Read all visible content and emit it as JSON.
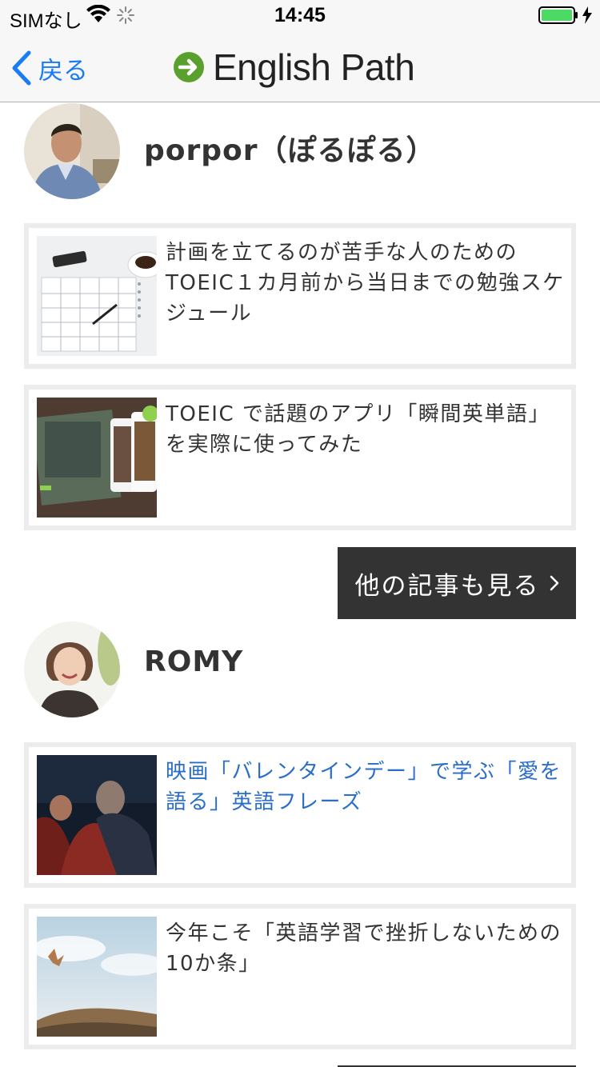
{
  "status_bar": {
    "carrier": "SIMなし",
    "time": "14:45",
    "wifi_icon": "wifi-icon",
    "battery_icon": "battery-icon",
    "battery_color": "#4cd964"
  },
  "nav": {
    "back_label": "戻る",
    "brand_name": "English Path",
    "accent": "#1a7cf5",
    "logo_color": "#5aa02c"
  },
  "authors": [
    {
      "name": "porpor（ぽるぽる）",
      "articles": [
        {
          "title": "計画を立てるのが苦手な人のためのTOEIC１カ月前から当日までの勉強スケジュール",
          "visited": false
        },
        {
          "title": "TOEIC で話題のアプリ「瞬間英単語」を実際に使ってみた",
          "visited": false
        }
      ],
      "more_label": "他の記事も見る"
    },
    {
      "name": "ROMY",
      "articles": [
        {
          "title": "映画「バレンタインデー」で学ぶ「愛を語る」英語フレーズ",
          "visited": true
        },
        {
          "title": "今年こそ「英語学習で挫折しないための10か条」",
          "visited": false
        }
      ]
    }
  ],
  "colors": {
    "card_border": "#ececec",
    "visited_link": "#2a6ec9",
    "more_button_bg": "#333333"
  }
}
